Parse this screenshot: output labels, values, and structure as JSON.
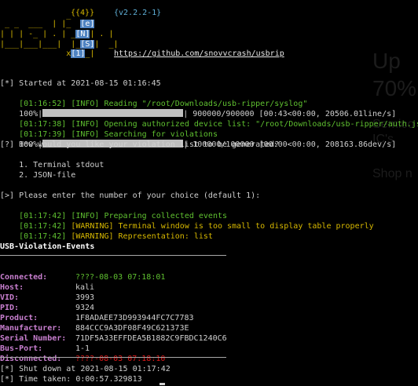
{
  "logo": {
    "brace": "{{4}}",
    "version": "{v2.2.2-1}",
    "art": [
      "              _",
      " _ _  ___  | |_  [e]",
      "| | | -_ | . | _[N]| . |",
      "|___|___|___|  |_[S]|  _|",
      "              x[1]_|"
    ],
    "url": "https://github.com/snovvcrash/usbrip"
  },
  "log": {
    "started": "[*] Started at 2021-08-15 01:16:45",
    "read_ts": "[01:16:52]",
    "read_msg": " [INFO] Reading \"/root/Downloads/usb-ripper/syslog\"",
    "progress1_pct": "100%|",
    "progress1_tail": "| 900000/900000 [00:43<00:00, 20506.01line/s]",
    "open_ts": "[01:17:38]",
    "open_msg": " [INFO] Opening authorized device list: \"/root/Downloads/usb-ripper/auth.json\"",
    "search_ts": "[01:17:39]",
    "search_msg": " [INFO] Searching for violations",
    "progress2_pct": "100%|",
    "progress2_tail": "| 100000/100000 [00:00<00:00, 208163.86dev/s]",
    "question": "[?] How would you like your violation list to be generated?",
    "option1": "    1. Terminal stdout",
    "option2": "    2. JSON-file",
    "prompt": "[>] Please enter the number of your choice (default 1):",
    "prep_ts": "[01:17:42]",
    "prep_msg": " [INFO] Preparing collected events",
    "warn1_ts": "[01:17:42]",
    "warn1_msg": " [WARNING] Terminal window is too small to display table properly",
    "warn2_ts": "[01:17:42]",
    "warn2_msg": " [WARNING] Representation: list",
    "table_title": "USB-Violation-Events",
    "shutdown": "[*] Shut down at 2021-08-15 01:17:42",
    "taken": "[*] Time taken: 0:00:57.329813"
  },
  "event": {
    "connected_label": "Connected:",
    "connected": "????-08-03 07:18:01",
    "host_label": "Host:",
    "host": "kali",
    "vid_label": "VID:",
    "vid": "3993",
    "pid_label": "PID:",
    "pid": "9324",
    "product_label": "Product:",
    "product": "1F8ADAEE73D993944FC7C7783",
    "manufacturer_label": "Manufacturer:",
    "manufacturer": "884CCC9A3DF08F49C621373E",
    "serial_label": "Serial Number:",
    "serial": "71DF5A33EFFDEA5B1882C9FBDC1240C6",
    "busport_label": "Bus-Port:",
    "busport": "1-1",
    "disconnected_label": "Disconnected:",
    "disconnected": "????-08-03 07:18:10"
  },
  "background": {
    "line1": "Up",
    "line2": "70%",
    "line3": "Semico",
    "line4": "IC's",
    "line5": "Shop n"
  },
  "colors": {
    "info": "#5fc030",
    "warning": "#d7b800",
    "label": "#c97fd0",
    "disconnected": "#e01818",
    "highlight": "#4f83c2"
  }
}
